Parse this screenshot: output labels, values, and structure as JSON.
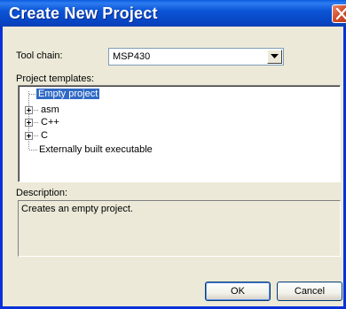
{
  "dialog": {
    "title": "Create New Project",
    "close_icon": "close-icon"
  },
  "toolchain": {
    "label": "Tool chain:",
    "value": "MSP430"
  },
  "templates": {
    "label": "Project templates:",
    "items": [
      {
        "label": "Empty project",
        "selected": true,
        "expandable": false
      },
      {
        "label": "asm",
        "selected": false,
        "expandable": true
      },
      {
        "label": "C++",
        "selected": false,
        "expandable": true
      },
      {
        "label": "C",
        "selected": false,
        "expandable": true
      },
      {
        "label": "Externally built executable",
        "selected": false,
        "expandable": false
      }
    ]
  },
  "description": {
    "label": "Description:",
    "text": "Creates an empty project."
  },
  "buttons": {
    "ok": "OK",
    "cancel": "Cancel"
  },
  "colors": {
    "titlebar": "#0846c5",
    "selection": "#316ac5",
    "close": "#d2502c"
  }
}
